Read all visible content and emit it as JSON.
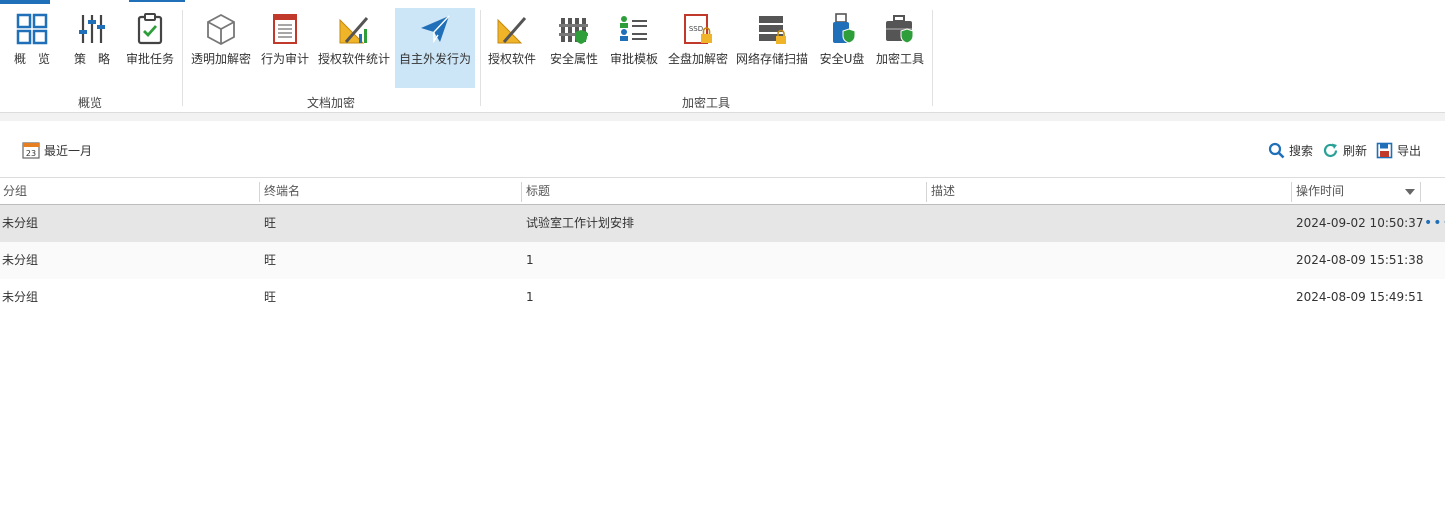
{
  "ribbon": {
    "groups": [
      {
        "label": "概览"
      },
      {
        "label": "文档加密"
      },
      {
        "label": "加密工具"
      }
    ],
    "buttons": [
      {
        "label": "概　览",
        "icon": "grid-overview-icon"
      },
      {
        "label": "策　略",
        "icon": "sliders-icon"
      },
      {
        "label": "审批任务",
        "icon": "clipboard-check-icon"
      },
      {
        "label": "透明加解密",
        "icon": "cube-icon"
      },
      {
        "label": "行为审计",
        "icon": "document-list-icon"
      },
      {
        "label": "授权软件统计",
        "icon": "ruler-pencil-chart-icon"
      },
      {
        "label": "自主外发行为",
        "icon": "paper-plane-icon"
      },
      {
        "label": "授权软件",
        "icon": "ruler-pencil-icon"
      },
      {
        "label": "安全属性",
        "icon": "fence-icon"
      },
      {
        "label": "审批模板",
        "icon": "users-list-icon"
      },
      {
        "label": "全盘加解密",
        "icon": "ssd-lock-icon"
      },
      {
        "label": "网络存储扫描",
        "icon": "server-lock-icon"
      },
      {
        "label": "安全U盘",
        "icon": "usb-shield-icon"
      },
      {
        "label": "加密工具",
        "icon": "toolbox-shield-icon"
      }
    ]
  },
  "toolbar": {
    "date_range": "最近一月",
    "calendar_day": "23",
    "search": "搜索",
    "refresh": "刷新",
    "export": "导出"
  },
  "table": {
    "columns": [
      "分组",
      "终端名",
      "标题",
      "描述",
      "操作时间"
    ],
    "rows": [
      {
        "group": "未分组",
        "terminal": "旺",
        "title": "试验室工作计划安排",
        "desc": "",
        "time": "2024-09-02 10:50:37"
      },
      {
        "group": "未分组",
        "terminal": "旺",
        "title": "1",
        "desc": "",
        "time": "2024-08-09 15:51:38"
      },
      {
        "group": "未分组",
        "terminal": "旺",
        "title": "1",
        "desc": "",
        "time": "2024-08-09 15:49:51"
      }
    ],
    "more_icon": "•••"
  },
  "colors": {
    "accent": "#1f6fb9",
    "active_bg": "#cde6f7",
    "selected_row": "#e6e6e6"
  }
}
